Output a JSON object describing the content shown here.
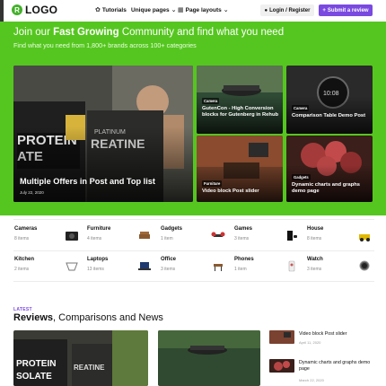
{
  "header": {
    "logo_mark": "R",
    "logo_text": "LOGO",
    "nav": [
      {
        "label": "Tutorials",
        "icon": "gear-icon"
      },
      {
        "label": "Unique pages",
        "icon": "chevron-down-icon"
      },
      {
        "label": "Page layouts",
        "icon": "grid-icon"
      }
    ],
    "login_label": "Login / Register",
    "submit_label": "Submit a review",
    "accent": "#7a4ae0"
  },
  "hero": {
    "title_pre": "Join our",
    "title_bold": "Fast Growing",
    "title_post": "Community and find what you need",
    "subtitle": "Find what you need from 1,800+ brands across 100+ categories",
    "band_color": "#55c61f"
  },
  "featured": {
    "main": {
      "title": "Multiple Offers in Post and Top list",
      "date": "July 22, 2020"
    },
    "cards": [
      {
        "tag": "Camera",
        "title": "GutenCon - High Conversion blocks for Gutenberg in Rehub"
      },
      {
        "tag": "Camera",
        "title": "Comparison Table Demo Post"
      },
      {
        "tag": "Furniture",
        "title": "Video block Post slider"
      },
      {
        "tag": "Gadgets",
        "title": "Dynamic charts and graphs demo page"
      }
    ]
  },
  "categories": [
    {
      "name": "Cameras",
      "count": "8 items",
      "icon": "camera-icon"
    },
    {
      "name": "Furniture",
      "count": "4 items",
      "icon": "furniture-icon"
    },
    {
      "name": "Gadgets",
      "count": "1 item",
      "icon": "drone-icon"
    },
    {
      "name": "Games",
      "count": "3 items",
      "icon": "console-icon"
    },
    {
      "name": "House",
      "count": "8 items",
      "icon": "house-icon"
    },
    {
      "name": "Kitchen",
      "count": "2 items",
      "icon": "kitchen-icon"
    },
    {
      "name": "Laptops",
      "count": "13 items",
      "icon": "laptop-icon"
    },
    {
      "name": "Office",
      "count": "3 items",
      "icon": "office-chair-icon"
    },
    {
      "name": "Phones",
      "count": "1 item",
      "icon": "phone-icon"
    },
    {
      "name": "Watch",
      "count": "3 items",
      "icon": "watch-icon"
    }
  ],
  "reviews": {
    "latest_label": "LATEST",
    "title_bold": "Reviews",
    "title_rest": ", Comparisons and News",
    "side": [
      {
        "title": "Video block Post slider",
        "date": "April 11, 2020"
      },
      {
        "title": "Dynamic charts and graphs demo page",
        "date": "March 22, 2020"
      }
    ]
  }
}
